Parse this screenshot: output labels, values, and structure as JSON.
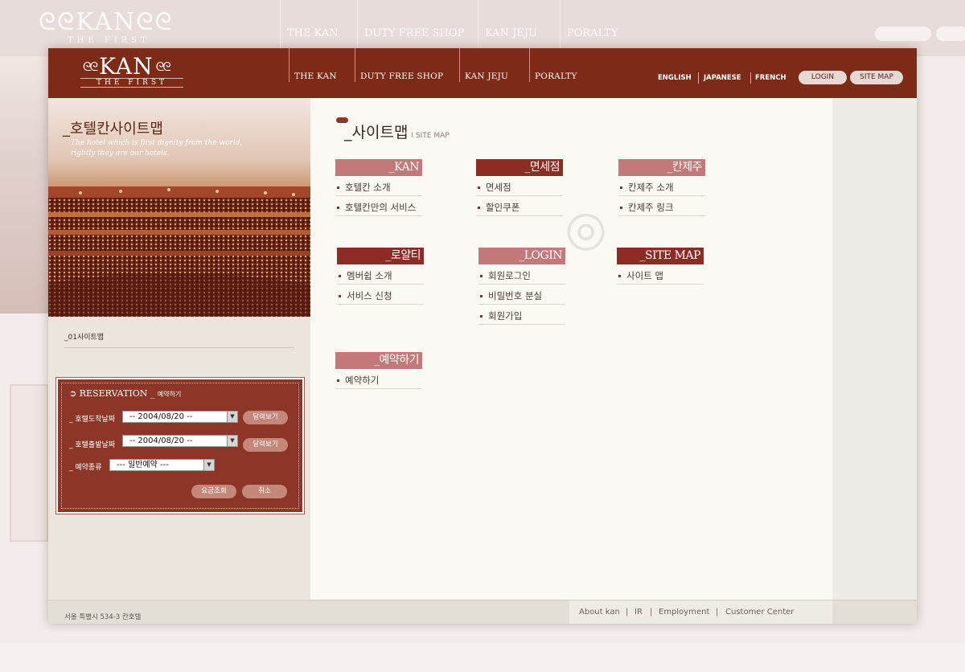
{
  "brand": {
    "name": "KAN",
    "ornament": "ᘓᘓ",
    "tagline": "THE FIRST"
  },
  "nav": [
    "THE KAN",
    "DUTY FREE SHOP",
    "KAN JEJU",
    "PORALTY"
  ],
  "languages": [
    "ENGLISH",
    "JAPANESE",
    "FRENCH"
  ],
  "top_buttons": {
    "login": "LOGIN",
    "sitemap": "SITE MAP"
  },
  "hero": {
    "title": "_호텔칸사이트맵",
    "description": "The hotel which is first dignity from the world, rightly they are our hotels."
  },
  "breadcrumb": "_01사이트맵",
  "reservation": {
    "heading": "RESERVATION _",
    "heading_sub": "예약하기",
    "checkin_label": "_ 호텔도착날짜",
    "checkin_value": "-- 2004/08/20 --",
    "checkout_label": "_ 호텔출발날짜",
    "checkout_value": "-- 2004/08/20 --",
    "type_label": "_ 예약종류",
    "type_value": "--- 일반예약 ---",
    "calendar_button": "달력보기",
    "rate_button": "요금조회",
    "cancel_button": "취소"
  },
  "page": {
    "title": "_사이트맵",
    "title_en": "I SITE MAP"
  },
  "sitemap": {
    "kan": {
      "label": "_KAN",
      "items": [
        "호텔칸 소개",
        "호텔칸만의 서비스"
      ]
    },
    "dutyfree": {
      "label": "_면세점",
      "items": [
        "면세점",
        "할인쿠폰"
      ]
    },
    "jeju": {
      "label": "_칸제주",
      "items": [
        "칸제주 소개",
        "칸제주 링크"
      ]
    },
    "royalty": {
      "label": "_로얄티",
      "items": [
        "멤버쉽 소개",
        "서비스 신청"
      ]
    },
    "login": {
      "label": "_LOGIN",
      "items": [
        "회원로그인",
        "비밀번호 분실",
        "회원가입"
      ]
    },
    "sitemap": {
      "label": "_SITE MAP",
      "items": [
        "사이트 맵"
      ]
    },
    "reserve": {
      "label": "_예약하기",
      "items": [
        "예약하기"
      ]
    }
  },
  "footer": {
    "address": "서울 특별시 534-3 칸호텔",
    "links": [
      "About kan",
      "IR",
      "Employment",
      "Customer Center"
    ],
    "separator": "|"
  },
  "colors": {
    "brand": "#7d2a16",
    "accent": "#8d3628",
    "light_tab": "#c3797a"
  }
}
